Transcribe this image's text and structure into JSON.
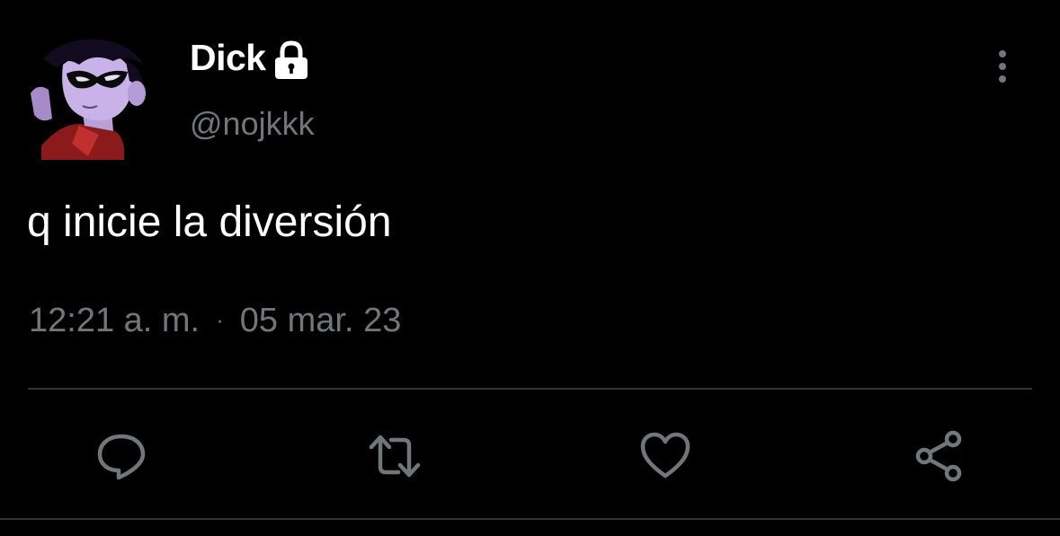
{
  "user": {
    "display_name": "Dick",
    "handle": "@nojkkk",
    "protected_icon": "lock-icon",
    "avatar_description_icon": "avatar"
  },
  "tweet": {
    "text": "q inicie la diversión",
    "time": "12:21 a. m.",
    "separator": "·",
    "date": "05 mar. 23"
  },
  "header": {
    "more_icon": "more-vertical-icon"
  },
  "actions": [
    {
      "icon": "reply-icon"
    },
    {
      "icon": "retweet-icon"
    },
    {
      "icon": "like-icon"
    },
    {
      "icon": "share-icon"
    }
  ],
  "colors": {
    "background": "#000000",
    "primary_text": "#ffffff",
    "secondary_text": "#71767b",
    "divider": "#2f3336"
  }
}
